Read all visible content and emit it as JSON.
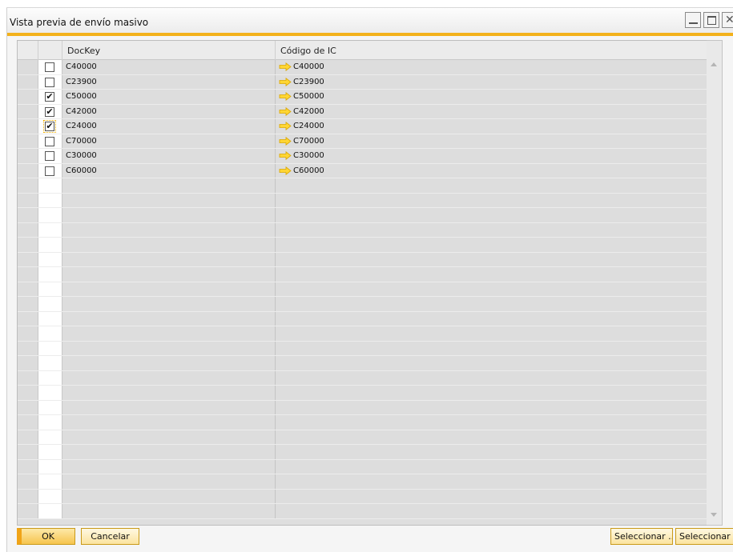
{
  "window": {
    "title": "Vista previa de envío masivo"
  },
  "grid": {
    "columns": [
      "DocKey",
      "Código de IC"
    ],
    "rows": [
      {
        "checked": false,
        "dockey": "C40000",
        "code": "C40000"
      },
      {
        "checked": false,
        "dockey": "C23900",
        "code": "C23900"
      },
      {
        "checked": true,
        "dockey": "C50000",
        "code": "C50000"
      },
      {
        "checked": true,
        "dockey": "C42000",
        "code": "C42000"
      },
      {
        "checked": true,
        "dockey": "C24000",
        "code": "C24000"
      },
      {
        "checked": false,
        "dockey": "C70000",
        "code": "C70000"
      },
      {
        "checked": false,
        "dockey": "C30000",
        "code": "C30000"
      },
      {
        "checked": false,
        "dockey": "C60000",
        "code": "C60000"
      }
    ],
    "check_glyph": "✔",
    "arrow_icon": "link-arrow-icon"
  },
  "buttons": {
    "ok": "OK",
    "cancel": "Cancelar",
    "select1": "Seleccionar ...",
    "select2": "Seleccionar ..."
  },
  "colors": {
    "accent": "#f3b11b",
    "arrow": "#f4c20d"
  }
}
